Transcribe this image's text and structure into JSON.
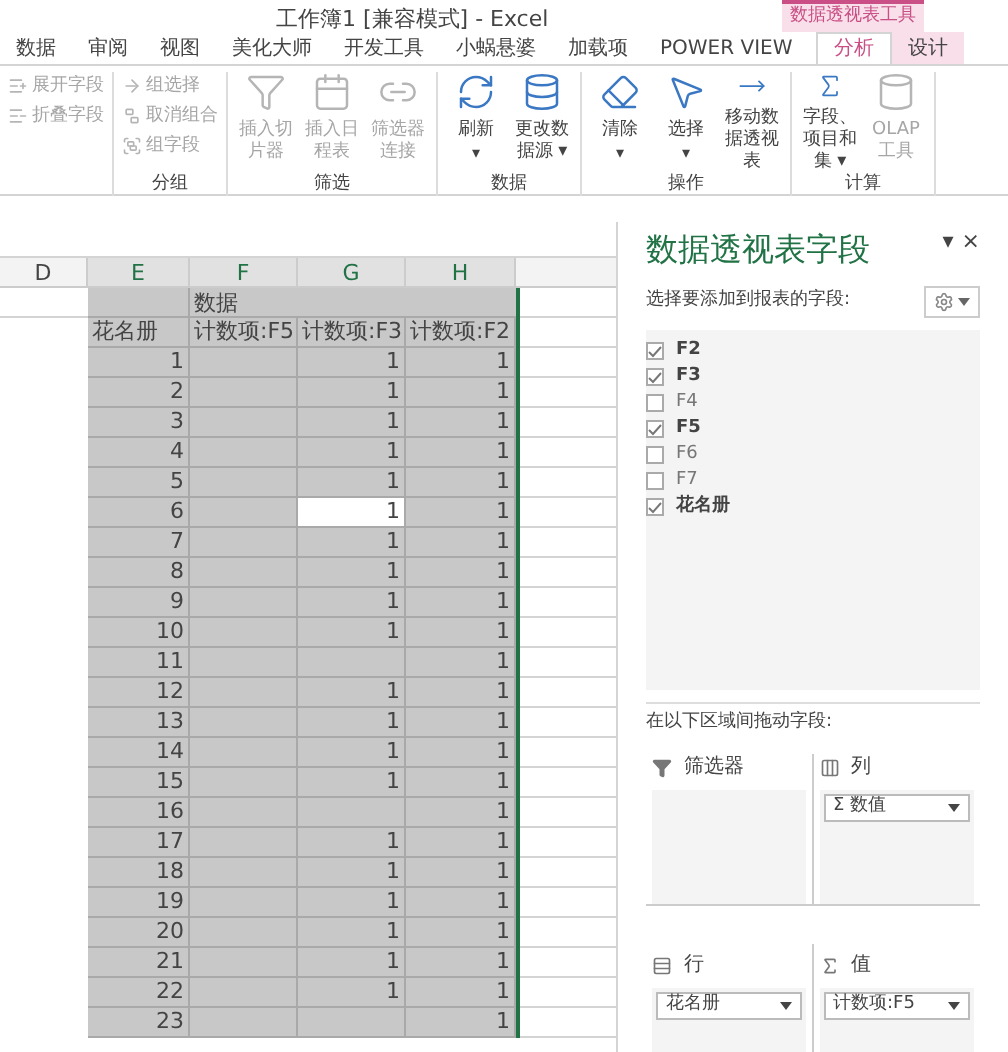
{
  "window": {
    "title": "工作簿1  [兼容模式] - Excel"
  },
  "context_tab": "数据透视表工具",
  "tabs": [
    {
      "label": "数据",
      "selected": false
    },
    {
      "label": "审阅",
      "selected": false
    },
    {
      "label": "视图",
      "selected": false
    },
    {
      "label": "美化大师",
      "selected": false
    },
    {
      "label": "开发工具",
      "selected": false
    },
    {
      "label": "小蜗悬婆",
      "selected": false
    },
    {
      "label": "加载项",
      "selected": false
    },
    {
      "label": "POWER VIEW",
      "selected": false
    },
    {
      "label": "分析",
      "selected": true
    },
    {
      "label": "设计",
      "selected": false
    }
  ],
  "ribbon_groups": [
    {
      "buttons": [
        {
          "kind": "small",
          "label": "展开字段",
          "disabled": true
        },
        {
          "kind": "small",
          "label": "折叠字段",
          "disabled": true
        }
      ]
    },
    {
      "label": "分组",
      "buttons": [
        {
          "kind": "small",
          "label": "组选择",
          "disabled": true
        },
        {
          "kind": "small",
          "label": "取消组合",
          "disabled": true
        },
        {
          "kind": "small",
          "label": "组字段",
          "disabled": true
        }
      ]
    },
    {
      "label": "筛选",
      "buttons": [
        {
          "kind": "large",
          "label": "插入切片器",
          "disabled": true
        },
        {
          "kind": "large",
          "label": "插入日程表",
          "disabled": true
        },
        {
          "kind": "large",
          "label": "筛选器连接",
          "disabled": true
        }
      ]
    },
    {
      "label": "数据",
      "buttons": [
        {
          "kind": "large",
          "label": "刷新",
          "caret": "▾",
          "disabled": false
        },
        {
          "kind": "large",
          "label": "更改数据源 ▾",
          "disabled": false
        }
      ]
    },
    {
      "label": "操作",
      "buttons": [
        {
          "kind": "large",
          "label": "清除",
          "caret": "▾",
          "disabled": false
        },
        {
          "kind": "large",
          "label": "选择",
          "caret": "▾",
          "disabled": false
        },
        {
          "kind": "large",
          "label": "移动数据透视表",
          "disabled": false
        }
      ]
    },
    {
      "label": "计算",
      "buttons": [
        {
          "kind": "large",
          "label": "字段、项目和集 ▾",
          "disabled": false
        },
        {
          "kind": "large",
          "label": "OLAP 工具",
          "disabled": true
        }
      ]
    }
  ],
  "sheet": {
    "columns": [
      "D",
      "E",
      "F",
      "G",
      "H"
    ],
    "data_header": "数据",
    "headers": [
      "花名册",
      "计数项:F5",
      "计数项:F3",
      "计数项:F2"
    ],
    "rows": [
      {
        "cells": [
          "1",
          null,
          "1",
          "1"
        ],
        "selected": [
          false,
          false,
          false,
          false
        ]
      },
      {
        "cells": [
          "2",
          null,
          "1",
          "1"
        ],
        "selected": [
          false,
          false,
          false,
          false
        ]
      },
      {
        "cells": [
          "3",
          null,
          "1",
          "1"
        ],
        "selected": [
          false,
          false,
          false,
          false
        ]
      },
      {
        "cells": [
          "4",
          null,
          "1",
          "1"
        ],
        "selected": [
          false,
          false,
          false,
          false
        ]
      },
      {
        "cells": [
          "5",
          null,
          "1",
          "1"
        ],
        "selected": [
          false,
          false,
          false,
          false
        ]
      },
      {
        "cells": [
          "6",
          null,
          "1",
          "1"
        ],
        "selected": [
          false,
          false,
          true,
          false
        ]
      },
      {
        "cells": [
          "7",
          null,
          "1",
          "1"
        ],
        "selected": [
          false,
          false,
          false,
          false
        ]
      },
      {
        "cells": [
          "8",
          null,
          "1",
          "1"
        ],
        "selected": [
          false,
          false,
          false,
          false
        ]
      },
      {
        "cells": [
          "9",
          null,
          "1",
          "1"
        ],
        "selected": [
          false,
          false,
          false,
          false
        ]
      },
      {
        "cells": [
          "10",
          null,
          "1",
          "1"
        ],
        "selected": [
          false,
          false,
          false,
          false
        ]
      },
      {
        "cells": [
          "11",
          null,
          null,
          "1"
        ],
        "selected": [
          false,
          false,
          false,
          false
        ]
      },
      {
        "cells": [
          "12",
          null,
          "1",
          "1"
        ],
        "selected": [
          false,
          false,
          false,
          false
        ]
      },
      {
        "cells": [
          "13",
          null,
          "1",
          "1"
        ],
        "selected": [
          false,
          false,
          false,
          false
        ]
      },
      {
        "cells": [
          "14",
          null,
          "1",
          "1"
        ],
        "selected": [
          false,
          false,
          false,
          false
        ]
      },
      {
        "cells": [
          "15",
          null,
          "1",
          "1"
        ],
        "selected": [
          false,
          false,
          false,
          false
        ]
      },
      {
        "cells": [
          "16",
          null,
          null,
          "1"
        ],
        "selected": [
          false,
          false,
          false,
          false
        ]
      },
      {
        "cells": [
          "17",
          null,
          "1",
          "1"
        ],
        "selected": [
          false,
          false,
          false,
          false
        ]
      },
      {
        "cells": [
          "18",
          null,
          "1",
          "1"
        ],
        "selected": [
          false,
          false,
          false,
          false
        ]
      },
      {
        "cells": [
          "19",
          null,
          "1",
          "1"
        ],
        "selected": [
          false,
          false,
          false,
          false
        ]
      },
      {
        "cells": [
          "20",
          null,
          "1",
          "1"
        ],
        "selected": [
          false,
          false,
          false,
          false
        ]
      },
      {
        "cells": [
          "21",
          null,
          "1",
          "1"
        ],
        "selected": [
          false,
          false,
          false,
          false
        ]
      },
      {
        "cells": [
          "22",
          null,
          "1",
          "1"
        ],
        "selected": [
          false,
          false,
          false,
          false
        ]
      },
      {
        "cells": [
          "23",
          null,
          null,
          "1"
        ],
        "selected": [
          false,
          false,
          false,
          false
        ]
      }
    ]
  },
  "pane": {
    "title": "数据透视表字段",
    "menu": "▾",
    "close": "×",
    "prompt": "选择要添加到报表的字段:",
    "fields": [
      {
        "label": "F2",
        "checked": true
      },
      {
        "label": "F3",
        "checked": true
      },
      {
        "label": "F4",
        "checked": false
      },
      {
        "label": "F5",
        "checked": true
      },
      {
        "label": "F6",
        "checked": false
      },
      {
        "label": "F7",
        "checked": false
      },
      {
        "label": "花名册",
        "checked": true
      }
    ],
    "drag_prompt": "在以下区域间拖动字段:",
    "areas": [
      {
        "kind": "filter",
        "label": "筛选器"
      },
      {
        "kind": "columns",
        "label": "列",
        "chips": [
          "Σ 数值"
        ]
      },
      {
        "kind": "rows",
        "label": "行",
        "chips": [
          "花名册"
        ]
      },
      {
        "kind": "values",
        "label": "值",
        "chips": [
          "计数项:F5"
        ]
      }
    ]
  }
}
